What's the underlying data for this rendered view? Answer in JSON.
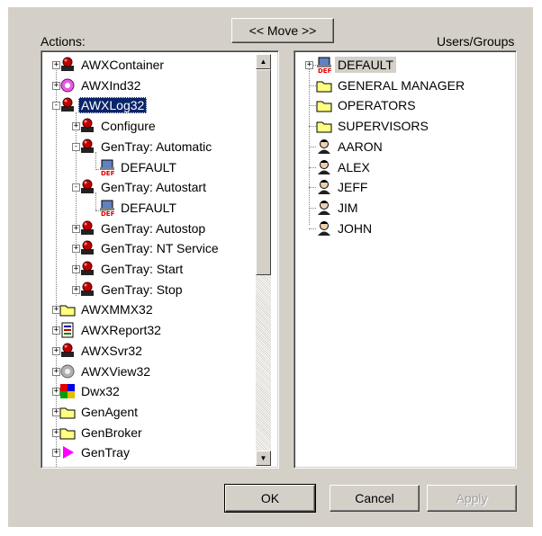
{
  "move_button": "<< Move >>",
  "actions_label": "Actions:",
  "users_label": "Users/Groups",
  "actions_tree": [
    {
      "label": "AWXContainer",
      "icon": "red-component-icon"
    },
    {
      "label": "AWXInd32",
      "icon": "magenta-gear-icon"
    },
    {
      "label": "AWXLog32",
      "icon": "red-component-icon"
    },
    {
      "label": "Configure",
      "icon": "red-component-icon"
    },
    {
      "label": "GenTray: Automatic",
      "icon": "red-component-icon"
    },
    {
      "label": "DEFAULT",
      "icon": "default-user-icon"
    },
    {
      "label": "GenTray: Autostart",
      "icon": "red-component-icon"
    },
    {
      "label": "DEFAULT",
      "icon": "default-user-icon"
    },
    {
      "label": "GenTray: Autostop",
      "icon": "red-component-icon"
    },
    {
      "label": "GenTray: NT Service",
      "icon": "red-component-icon"
    },
    {
      "label": "GenTray: Start",
      "icon": "red-component-icon"
    },
    {
      "label": "GenTray: Stop",
      "icon": "red-component-icon"
    },
    {
      "label": "AWXMMX32",
      "icon": "folder-icon"
    },
    {
      "label": "AWXReport32",
      "icon": "report-icon"
    },
    {
      "label": "AWXSvr32",
      "icon": "red-component-icon"
    },
    {
      "label": "AWXView32",
      "icon": "gray-gear-icon"
    },
    {
      "label": "Dwx32",
      "icon": "colorful-puzzle-icon"
    },
    {
      "label": "GenAgent",
      "icon": "folder-icon"
    },
    {
      "label": "GenBroker",
      "icon": "folder-icon"
    },
    {
      "label": "GenTray",
      "icon": "magenta-arrow-icon"
    }
  ],
  "users_tree": [
    {
      "label": "DEFAULT",
      "icon": "default-user-icon"
    },
    {
      "label": "GENERAL MANAGER",
      "icon": "folder-icon"
    },
    {
      "label": "OPERATORS",
      "icon": "folder-icon"
    },
    {
      "label": "SUPERVISORS",
      "icon": "folder-icon"
    },
    {
      "label": "AARON",
      "icon": "user-icon"
    },
    {
      "label": "ALEX",
      "icon": "user-icon"
    },
    {
      "label": "JEFF",
      "icon": "user-icon"
    },
    {
      "label": "JIM",
      "icon": "user-icon"
    },
    {
      "label": "JOHN",
      "icon": "user-icon"
    }
  ],
  "buttons": {
    "ok": "OK",
    "cancel": "Cancel",
    "apply": "Apply"
  }
}
